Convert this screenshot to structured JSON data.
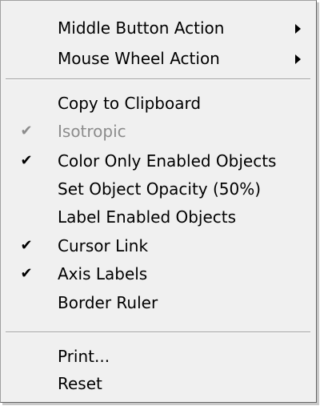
{
  "menu": {
    "items": [
      {
        "label": "Middle Button Action",
        "submenu": true
      },
      {
        "label": "Mouse Wheel Action",
        "submenu": true
      },
      {
        "label": "Copy to Clipboard"
      },
      {
        "label": "Isotropic",
        "checked": true,
        "disabled": true
      },
      {
        "label": "Color Only Enabled Objects",
        "checked": true
      },
      {
        "label": "Set Object Opacity (50%)"
      },
      {
        "label": "Label Enabled Objects"
      },
      {
        "label": "Cursor Link",
        "checked": true
      },
      {
        "label": "Axis Labels",
        "checked": true
      },
      {
        "label": "Border Ruler"
      },
      {
        "label": "Print..."
      },
      {
        "label": "Reset"
      }
    ],
    "check_glyph": "✔"
  }
}
